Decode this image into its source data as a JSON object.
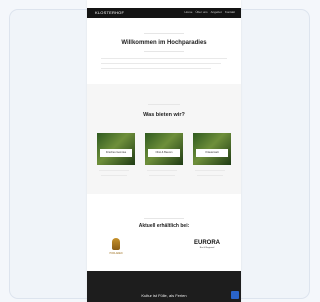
{
  "site": {
    "logo_text": "KLOSTERHOF",
    "nav": [
      "Home",
      "Über uns",
      "Angebot",
      "Kontakt"
    ]
  },
  "hero": {
    "title": "Willkommen im Hochparadies"
  },
  "features": {
    "title": "Was bieten wir?",
    "items": [
      "Frisches Gemüse",
      "Obst & Beeren",
      "Kräuterwelt"
    ]
  },
  "partners": {
    "title": "Aktuell erhältlich bei:",
    "left_logo_text": "HOFLADEN",
    "right_logo_title": "EURORA",
    "right_logo_sub": "Bio & Regional"
  },
  "footer": {
    "text": "Kultur ist Fülle, als Ferien"
  }
}
